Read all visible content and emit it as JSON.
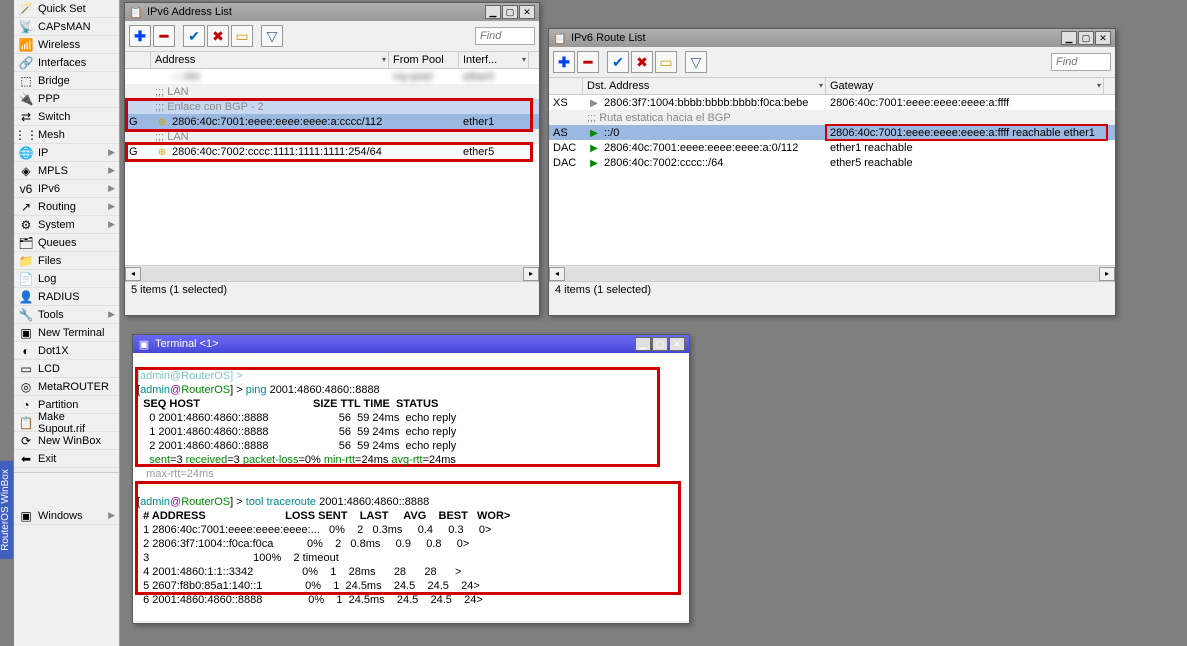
{
  "sidebar": {
    "items": [
      {
        "icon": "🪄",
        "label": "Quick Set",
        "chevron": false
      },
      {
        "icon": "📡",
        "label": "CAPsMAN",
        "chevron": false
      },
      {
        "icon": "📶",
        "label": "Wireless",
        "chevron": false
      },
      {
        "icon": "🔗",
        "label": "Interfaces",
        "chevron": false
      },
      {
        "icon": "⬚",
        "label": "Bridge",
        "chevron": false
      },
      {
        "icon": "🔌",
        "label": "PPP",
        "chevron": false
      },
      {
        "icon": "⇄",
        "label": "Switch",
        "chevron": false
      },
      {
        "icon": "⋮⋮",
        "label": "Mesh",
        "chevron": false
      },
      {
        "icon": "🌐",
        "label": "IP",
        "chevron": true
      },
      {
        "icon": "◈",
        "label": "MPLS",
        "chevron": true
      },
      {
        "icon": "v6",
        "label": "IPv6",
        "chevron": true
      },
      {
        "icon": "↗",
        "label": "Routing",
        "chevron": true
      },
      {
        "icon": "⚙",
        "label": "System",
        "chevron": true
      },
      {
        "icon": "🗂",
        "label": "Queues",
        "chevron": false
      },
      {
        "icon": "📁",
        "label": "Files",
        "chevron": false
      },
      {
        "icon": "📄",
        "label": "Log",
        "chevron": false
      },
      {
        "icon": "👤",
        "label": "RADIUS",
        "chevron": false
      },
      {
        "icon": "🔧",
        "label": "Tools",
        "chevron": true
      },
      {
        "icon": "▣",
        "label": "New Terminal",
        "chevron": false
      },
      {
        "icon": "◐",
        "label": "Dot1X",
        "chevron": false
      },
      {
        "icon": "▭",
        "label": "LCD",
        "chevron": false
      },
      {
        "icon": "◎",
        "label": "MetaROUTER",
        "chevron": false
      },
      {
        "icon": "◔",
        "label": "Partition",
        "chevron": false
      },
      {
        "icon": "📋",
        "label": "Make Supout.rif",
        "chevron": false
      },
      {
        "icon": "⟳",
        "label": "New WinBox",
        "chevron": false
      },
      {
        "icon": "⬅",
        "label": "Exit",
        "chevron": false
      }
    ],
    "windows_item": {
      "icon": "▣",
      "label": "Windows",
      "chevron": true
    }
  },
  "vert_label": "RouterOS WinBox",
  "find_placeholder": "Find",
  "addr_window": {
    "title": "IPv6 Address List",
    "columns": {
      "c1": "",
      "c2": "Address",
      "c3": "From Pool",
      "c4": "Interf..."
    },
    "rows": [
      {
        "flag": "",
        "type": "blur",
        "addr": "::::/64",
        "pool": "my-pool",
        "iface": "ether5"
      },
      {
        "flag": "",
        "type": "comment",
        "addr": ";;; LAN"
      },
      {
        "flag": "",
        "type": "comment-sel",
        "addr": ";;; Enlace con BGP - 2"
      },
      {
        "flag": "G",
        "type": "selected",
        "icon": "⊕",
        "addr": "2806:40c:7001:eeee:eeee:eeee:a:cccc/112",
        "pool": "",
        "iface": "ether1"
      },
      {
        "flag": "",
        "type": "comment",
        "addr": ";;; LAN"
      },
      {
        "flag": "G",
        "type": "normal",
        "icon": "⊕",
        "addr": "2806:40c:7002:cccc:1111:1111:1111:254/64",
        "pool": "",
        "iface": "ether5"
      },
      {
        "flag": "",
        "type": "blur2",
        "addr": "",
        "pool": "",
        "iface": ""
      }
    ],
    "status": "5 items (1 selected)"
  },
  "route_window": {
    "title": "IPv6 Route List",
    "columns": {
      "c1": "",
      "c2": "Dst. Address",
      "c3": "Gateway"
    },
    "rows": [
      {
        "flag": "XS",
        "icon": "▶",
        "dst": "2806:3f7:1004:bbbb:bbbb:bbbb:f0ca:bebe",
        "gw": "2806:40c:7001:eeee:eeee:eeee:a:ffff"
      },
      {
        "flag": "",
        "type": "comment",
        "dst": ";;; Ruta estatica hacia el BGP"
      },
      {
        "flag": "AS",
        "type": "selected",
        "icon": "▶",
        "dst": "::/0",
        "gw": "2806:40c:7001:eeee:eeee:eeee:a:ffff reachable ether1"
      },
      {
        "flag": "DAC",
        "icon": "▶",
        "dst": "2806:40c:7001:eeee:eeee:eeee:a:0/112",
        "gw": "ether1 reachable"
      },
      {
        "flag": "DAC",
        "icon": "▶",
        "dst": "2806:40c:7002:cccc::/64",
        "gw": "ether5 reachable"
      }
    ],
    "status": "4 items (1 selected)"
  },
  "terminal_window": {
    "title": "Terminal <1>",
    "prompt_open": "[",
    "prompt_user": "admin",
    "prompt_at": "@",
    "prompt_host": "RouterOS",
    "prompt_close": "] > ",
    "ping_cmd": "ping",
    "ping_arg": " 2001:4860:4860::8888",
    "ping_header": "  SEQ HOST                                     SIZE TTL TIME  STATUS",
    "ping_rows": [
      "    0 2001:4860:4860::8888                       56  59 24ms  echo reply",
      "    1 2001:4860:4860::8888                       56  59 24ms  echo reply",
      "    2 2001:4860:4860::8888                       56  59 24ms  echo reply"
    ],
    "ping_summary_pre": "    ",
    "ping_sent": "sent",
    "ping_sent_v": "=3 ",
    "ping_recv": "received",
    "ping_recv_v": "=3 ",
    "ping_loss": "packet-loss",
    "ping_loss_v": "=0% ",
    "ping_min": "min-rtt",
    "ping_min_v": "=24ms ",
    "ping_avg": "avg-rtt",
    "ping_avg_v": "=24ms",
    "ping_maxrow": "   max-rtt=24ms",
    "tr_cmd": "tool traceroute",
    "tr_arg": " 2001:4860:4860::8888",
    "tr_header": "  # ADDRESS                          LOSS SENT    LAST     AVG    BEST   WOR>",
    "tr_rows": [
      "  1 2806:40c:7001:eeee:eeee:eeee:...   0%    2   0.3ms     0.4     0.3     0>",
      "  2 2806:3f7:1004::f0ca:f0ca           0%    2   0.8ms     0.9     0.8     0>",
      "  3                                  100%    2 timeout",
      "  4 2001:4860:1:1::3342                0%    1    28ms      28      28      >",
      "  5 2607:f8b0:85a1:140::1              0%    1  24.5ms    24.5    24.5    24>",
      "  6 2001:4860:4860::8888               0%    1  24.5ms    24.5    24.5    24>"
    ],
    "cursor": "█"
  }
}
